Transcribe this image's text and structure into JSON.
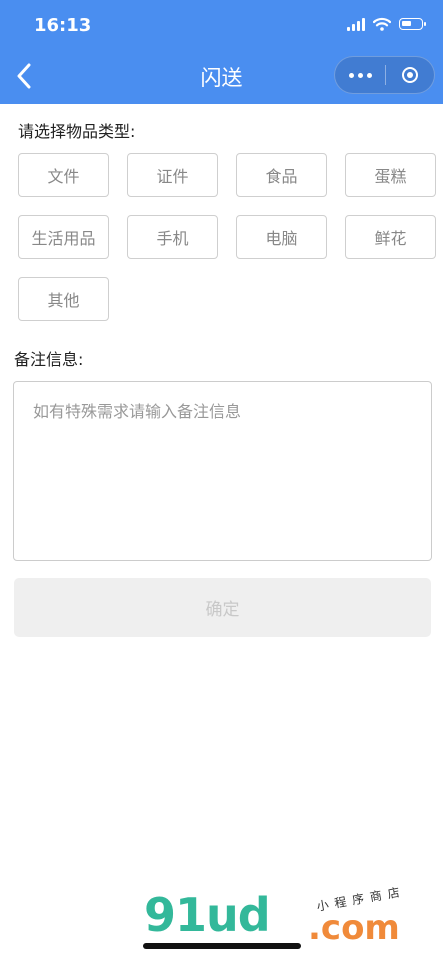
{
  "status_bar": {
    "time": "16:13",
    "battery_level": 0.55
  },
  "nav": {
    "title": "闪送"
  },
  "item_type": {
    "label": "请选择物品类型:",
    "options": [
      "文件",
      "证件",
      "食品",
      "蛋糕",
      "生活用品",
      "手机",
      "电脑",
      "鲜花",
      "其他"
    ]
  },
  "remarks": {
    "label": "备注信息:",
    "placeholder": "如有特殊需求请输入备注信息"
  },
  "confirm_label": "确定",
  "watermark": {
    "logo_main": "91ud",
    "logo_suffix": ".com",
    "tagline": "小程序商店"
  },
  "colors": {
    "header": "#4a8ef0",
    "chip_border": "#cfcfcf",
    "button_bg": "#efefef"
  }
}
